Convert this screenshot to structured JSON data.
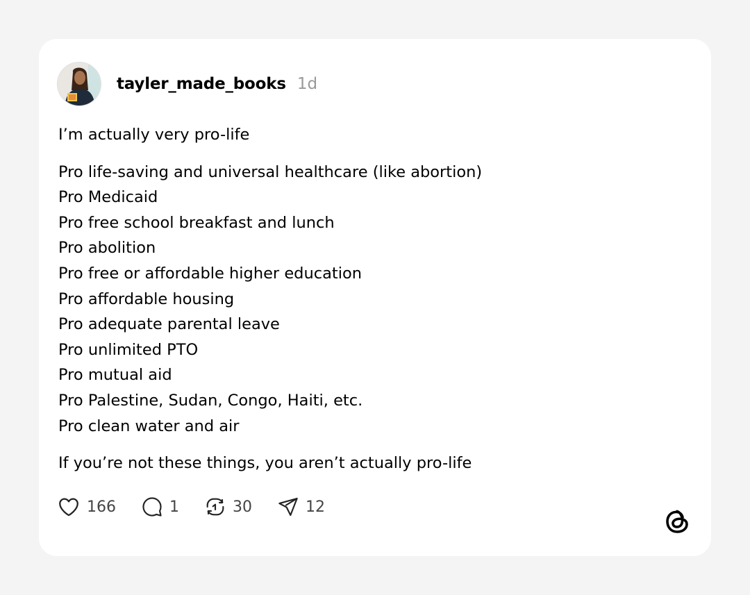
{
  "post": {
    "author": {
      "username": "tayler_made_books",
      "timestamp": "1d"
    },
    "intro": "I’m actually very pro-life",
    "items": [
      "Pro life-saving and universal healthcare (like abortion)",
      "Pro Medicaid",
      "Pro free school breakfast and lunch",
      "Pro abolition",
      "Pro free or affordable higher education",
      "Pro affordable housing",
      "Pro adequate parental leave",
      "Pro unlimited PTO",
      "Pro mutual aid",
      "Pro Palestine, Sudan, Congo, Haiti, etc.",
      "Pro clean water and air"
    ],
    "closing": "If you’re not these things, you aren’t actually pro-life"
  },
  "actions": {
    "likes": "166",
    "replies": "1",
    "reposts": "30",
    "shares": "12"
  },
  "icons": {
    "like": "heart-icon",
    "reply": "comment-bubble-icon",
    "repost": "repost-icon",
    "share": "send-icon",
    "brand": "threads-logo-icon"
  },
  "colors": {
    "background": "#f4f4f4",
    "card": "#ffffff",
    "text": "#000000",
    "muted": "#999999"
  }
}
